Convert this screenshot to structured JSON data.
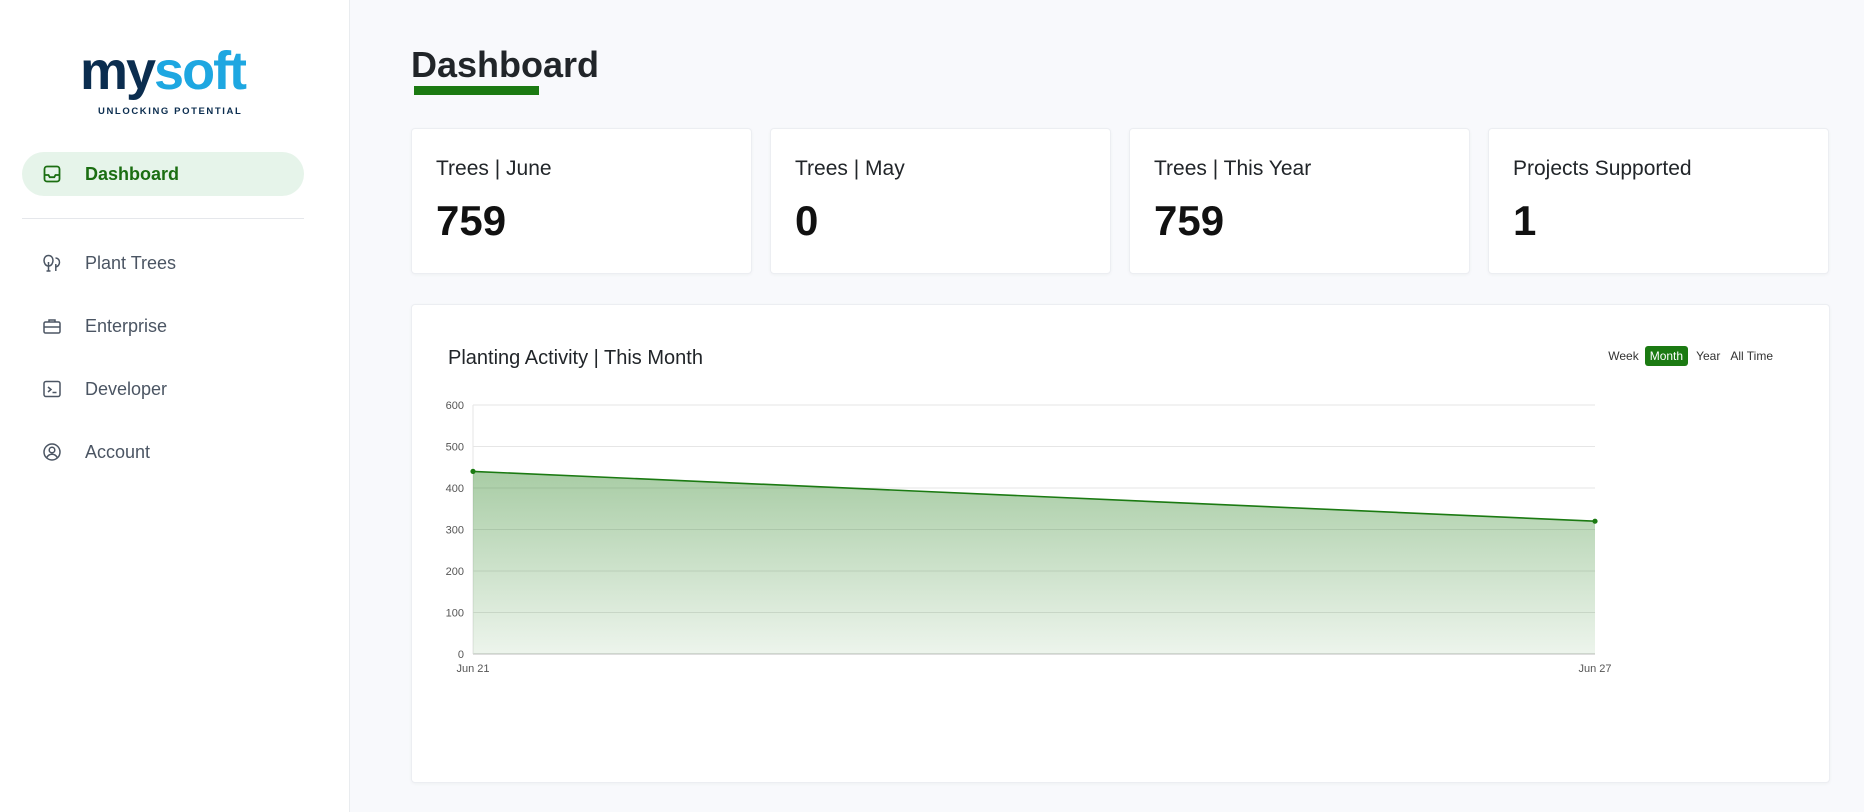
{
  "brand": {
    "logo_text_my": "my",
    "logo_text_soft": "soft",
    "tagline": "UNLOCKING POTENTIAL"
  },
  "sidebar": {
    "items": [
      {
        "label": "Dashboard",
        "icon": "inbox-icon",
        "active": true
      },
      {
        "label": "Plant Trees",
        "icon": "trees-icon"
      },
      {
        "label": "Enterprise",
        "icon": "briefcase-icon"
      },
      {
        "label": "Developer",
        "icon": "terminal-icon"
      },
      {
        "label": "Account",
        "icon": "user-circle-icon"
      }
    ]
  },
  "page": {
    "title": "Dashboard"
  },
  "stats": [
    {
      "label": "Trees | June",
      "value": "759"
    },
    {
      "label": "Trees | May",
      "value": "0"
    },
    {
      "label": "Trees | This Year",
      "value": "759"
    },
    {
      "label": "Projects Supported",
      "value": "1"
    }
  ],
  "activity": {
    "title": "Planting Activity | This Month",
    "ranges": [
      "Week",
      "Month",
      "Year",
      "All Time"
    ],
    "selected_range": "Month"
  },
  "colors": {
    "accent": "#1b7a12",
    "accent_light": "#e6f4ea",
    "logo_navy": "#0b2d4f",
    "logo_blue": "#1ea7e1"
  },
  "chart_data": {
    "type": "area",
    "x": [
      "Jun 21",
      "Jun 27"
    ],
    "series": [
      {
        "values": [
          440,
          320
        ]
      }
    ],
    "ylim": [
      0,
      600
    ],
    "yticks": [
      0,
      100,
      200,
      300,
      400,
      500,
      600
    ],
    "grid": true,
    "legend": "none"
  }
}
